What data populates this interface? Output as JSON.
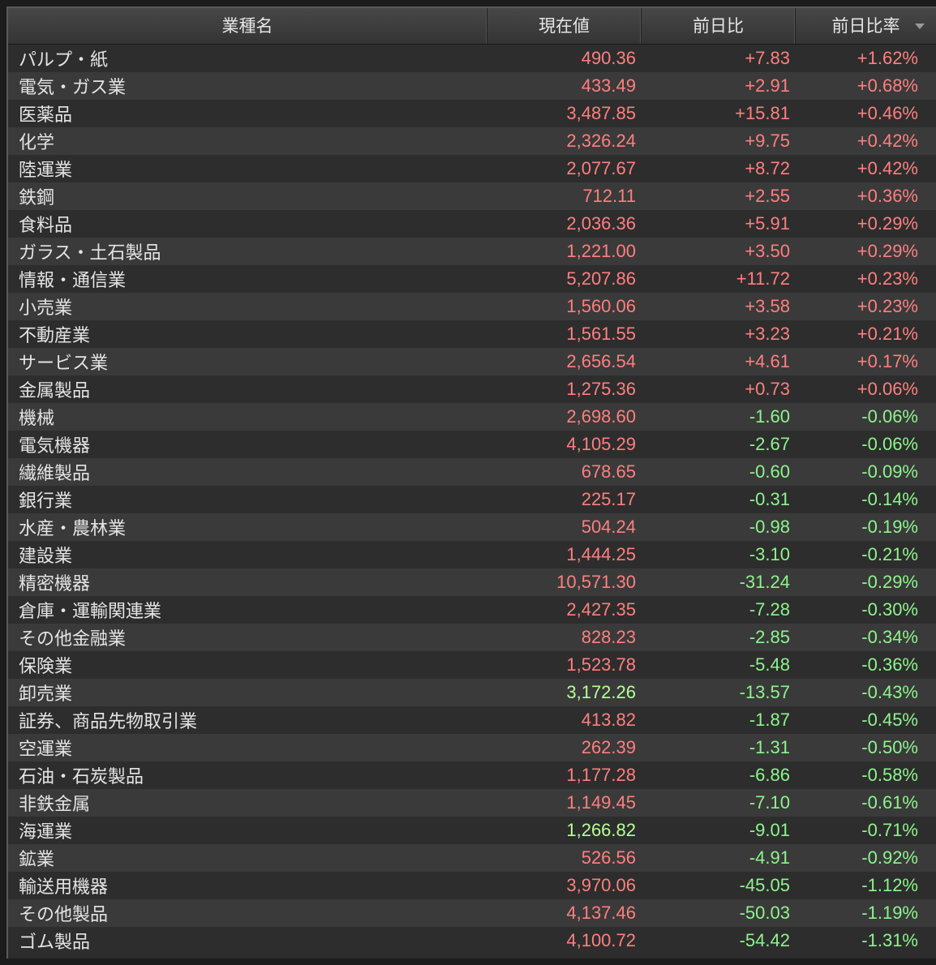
{
  "header": {
    "name": "業種名",
    "price": "現在値",
    "change": "前日比",
    "change_pct": "前日比率"
  },
  "colors": {
    "up": "#ff7f7f",
    "down": "#8cf58c"
  },
  "rows": [
    {
      "name": "パルプ・紙",
      "price": "490.36",
      "change": "+7.83",
      "pct": "+1.62%",
      "price_dir": "up",
      "dir": "up"
    },
    {
      "name": "電気・ガス業",
      "price": "433.49",
      "change": "+2.91",
      "pct": "+0.68%",
      "price_dir": "up",
      "dir": "up"
    },
    {
      "name": "医薬品",
      "price": "3,487.85",
      "change": "+15.81",
      "pct": "+0.46%",
      "price_dir": "up",
      "dir": "up"
    },
    {
      "name": "化学",
      "price": "2,326.24",
      "change": "+9.75",
      "pct": "+0.42%",
      "price_dir": "up",
      "dir": "up"
    },
    {
      "name": "陸運業",
      "price": "2,077.67",
      "change": "+8.72",
      "pct": "+0.42%",
      "price_dir": "up",
      "dir": "up"
    },
    {
      "name": "鉄鋼",
      "price": "712.11",
      "change": "+2.55",
      "pct": "+0.36%",
      "price_dir": "up",
      "dir": "up"
    },
    {
      "name": "食料品",
      "price": "2,036.36",
      "change": "+5.91",
      "pct": "+0.29%",
      "price_dir": "up",
      "dir": "up"
    },
    {
      "name": "ガラス・土石製品",
      "price": "1,221.00",
      "change": "+3.50",
      "pct": "+0.29%",
      "price_dir": "up",
      "dir": "up"
    },
    {
      "name": "情報・通信業",
      "price": "5,207.86",
      "change": "+11.72",
      "pct": "+0.23%",
      "price_dir": "up",
      "dir": "up"
    },
    {
      "name": "小売業",
      "price": "1,560.06",
      "change": "+3.58",
      "pct": "+0.23%",
      "price_dir": "up",
      "dir": "up"
    },
    {
      "name": "不動産業",
      "price": "1,561.55",
      "change": "+3.23",
      "pct": "+0.21%",
      "price_dir": "up",
      "dir": "up"
    },
    {
      "name": "サービス業",
      "price": "2,656.54",
      "change": "+4.61",
      "pct": "+0.17%",
      "price_dir": "up",
      "dir": "up"
    },
    {
      "name": "金属製品",
      "price": "1,275.36",
      "change": "+0.73",
      "pct": "+0.06%",
      "price_dir": "up",
      "dir": "up"
    },
    {
      "name": "機械",
      "price": "2,698.60",
      "change": "-1.60",
      "pct": "-0.06%",
      "price_dir": "up",
      "dir": "down"
    },
    {
      "name": "電気機器",
      "price": "4,105.29",
      "change": "-2.67",
      "pct": "-0.06%",
      "price_dir": "up",
      "dir": "down"
    },
    {
      "name": "繊維製品",
      "price": "678.65",
      "change": "-0.60",
      "pct": "-0.09%",
      "price_dir": "up",
      "dir": "down"
    },
    {
      "name": "銀行業",
      "price": "225.17",
      "change": "-0.31",
      "pct": "-0.14%",
      "price_dir": "up",
      "dir": "down"
    },
    {
      "name": "水産・農林業",
      "price": "504.24",
      "change": "-0.98",
      "pct": "-0.19%",
      "price_dir": "up",
      "dir": "down"
    },
    {
      "name": "建設業",
      "price": "1,444.25",
      "change": "-3.10",
      "pct": "-0.21%",
      "price_dir": "up",
      "dir": "down"
    },
    {
      "name": "精密機器",
      "price": "10,571.30",
      "change": "-31.24",
      "pct": "-0.29%",
      "price_dir": "up",
      "dir": "down"
    },
    {
      "name": "倉庫・運輸関連業",
      "price": "2,427.35",
      "change": "-7.28",
      "pct": "-0.30%",
      "price_dir": "up",
      "dir": "down"
    },
    {
      "name": "その他金融業",
      "price": "828.23",
      "change": "-2.85",
      "pct": "-0.34%",
      "price_dir": "up",
      "dir": "down"
    },
    {
      "name": "保険業",
      "price": "1,523.78",
      "change": "-5.48",
      "pct": "-0.36%",
      "price_dir": "up",
      "dir": "down"
    },
    {
      "name": "卸売業",
      "price": "3,172.26",
      "change": "-13.57",
      "pct": "-0.43%",
      "price_dir": "green",
      "dir": "down"
    },
    {
      "name": "証券、商品先物取引業",
      "price": "413.82",
      "change": "-1.87",
      "pct": "-0.45%",
      "price_dir": "up",
      "dir": "down"
    },
    {
      "name": "空運業",
      "price": "262.39",
      "change": "-1.31",
      "pct": "-0.50%",
      "price_dir": "up",
      "dir": "down"
    },
    {
      "name": "石油・石炭製品",
      "price": "1,177.28",
      "change": "-6.86",
      "pct": "-0.58%",
      "price_dir": "up",
      "dir": "down"
    },
    {
      "name": "非鉄金属",
      "price": "1,149.45",
      "change": "-7.10",
      "pct": "-0.61%",
      "price_dir": "up",
      "dir": "down"
    },
    {
      "name": "海運業",
      "price": "1,266.82",
      "change": "-9.01",
      "pct": "-0.71%",
      "price_dir": "green",
      "dir": "down"
    },
    {
      "name": "鉱業",
      "price": "526.56",
      "change": "-4.91",
      "pct": "-0.92%",
      "price_dir": "up",
      "dir": "down"
    },
    {
      "name": "輸送用機器",
      "price": "3,970.06",
      "change": "-45.05",
      "pct": "-1.12%",
      "price_dir": "up",
      "dir": "down"
    },
    {
      "name": "その他製品",
      "price": "4,137.46",
      "change": "-50.03",
      "pct": "-1.19%",
      "price_dir": "up",
      "dir": "down"
    },
    {
      "name": "ゴム製品",
      "price": "4,100.72",
      "change": "-54.42",
      "pct": "-1.31%",
      "price_dir": "up",
      "dir": "down"
    }
  ]
}
